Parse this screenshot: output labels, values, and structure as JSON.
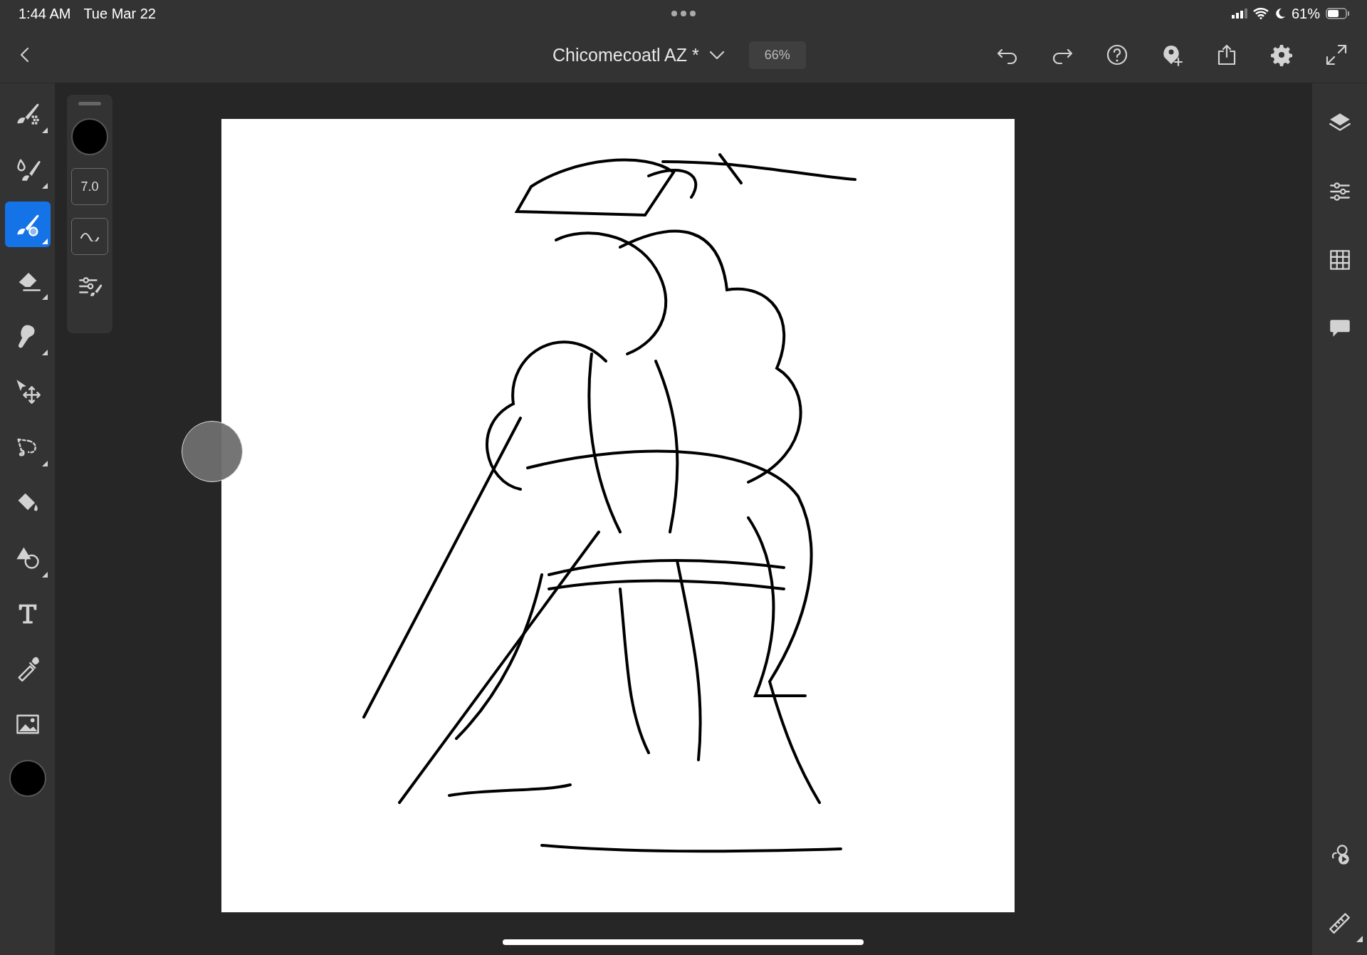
{
  "status_bar": {
    "time": "1:44 AM",
    "date": "Tue Mar 22",
    "battery": "61%"
  },
  "top_bar": {
    "title": "Chicomecoatl AZ *",
    "zoom": "66%"
  },
  "tools": [
    {
      "kind": "pixel",
      "selected": false,
      "flyout": true
    },
    {
      "kind": "live",
      "selected": false,
      "flyout": true
    },
    {
      "kind": "vector",
      "selected": true,
      "flyout": true
    },
    {
      "kind": "eraser",
      "selected": false,
      "flyout": true
    },
    {
      "kind": "smudge",
      "selected": false,
      "flyout": true
    },
    {
      "kind": "move",
      "selected": false,
      "flyout": false
    },
    {
      "kind": "lasso",
      "selected": false,
      "flyout": true
    },
    {
      "kind": "fill",
      "selected": false,
      "flyout": false
    },
    {
      "kind": "shape",
      "selected": false,
      "flyout": true
    },
    {
      "kind": "text",
      "selected": false,
      "flyout": false
    },
    {
      "kind": "eyedropper",
      "selected": false,
      "flyout": false
    },
    {
      "kind": "image",
      "selected": false,
      "flyout": false
    }
  ],
  "brush_panel": {
    "size": "7.0"
  },
  "right_rail": {
    "top": [
      {
        "kind": "layers"
      },
      {
        "kind": "adjust"
      },
      {
        "kind": "grid"
      },
      {
        "kind": "comment"
      }
    ],
    "bottom": [
      {
        "kind": "livestream",
        "flyout": false
      },
      {
        "kind": "ruler",
        "flyout": true
      }
    ]
  }
}
